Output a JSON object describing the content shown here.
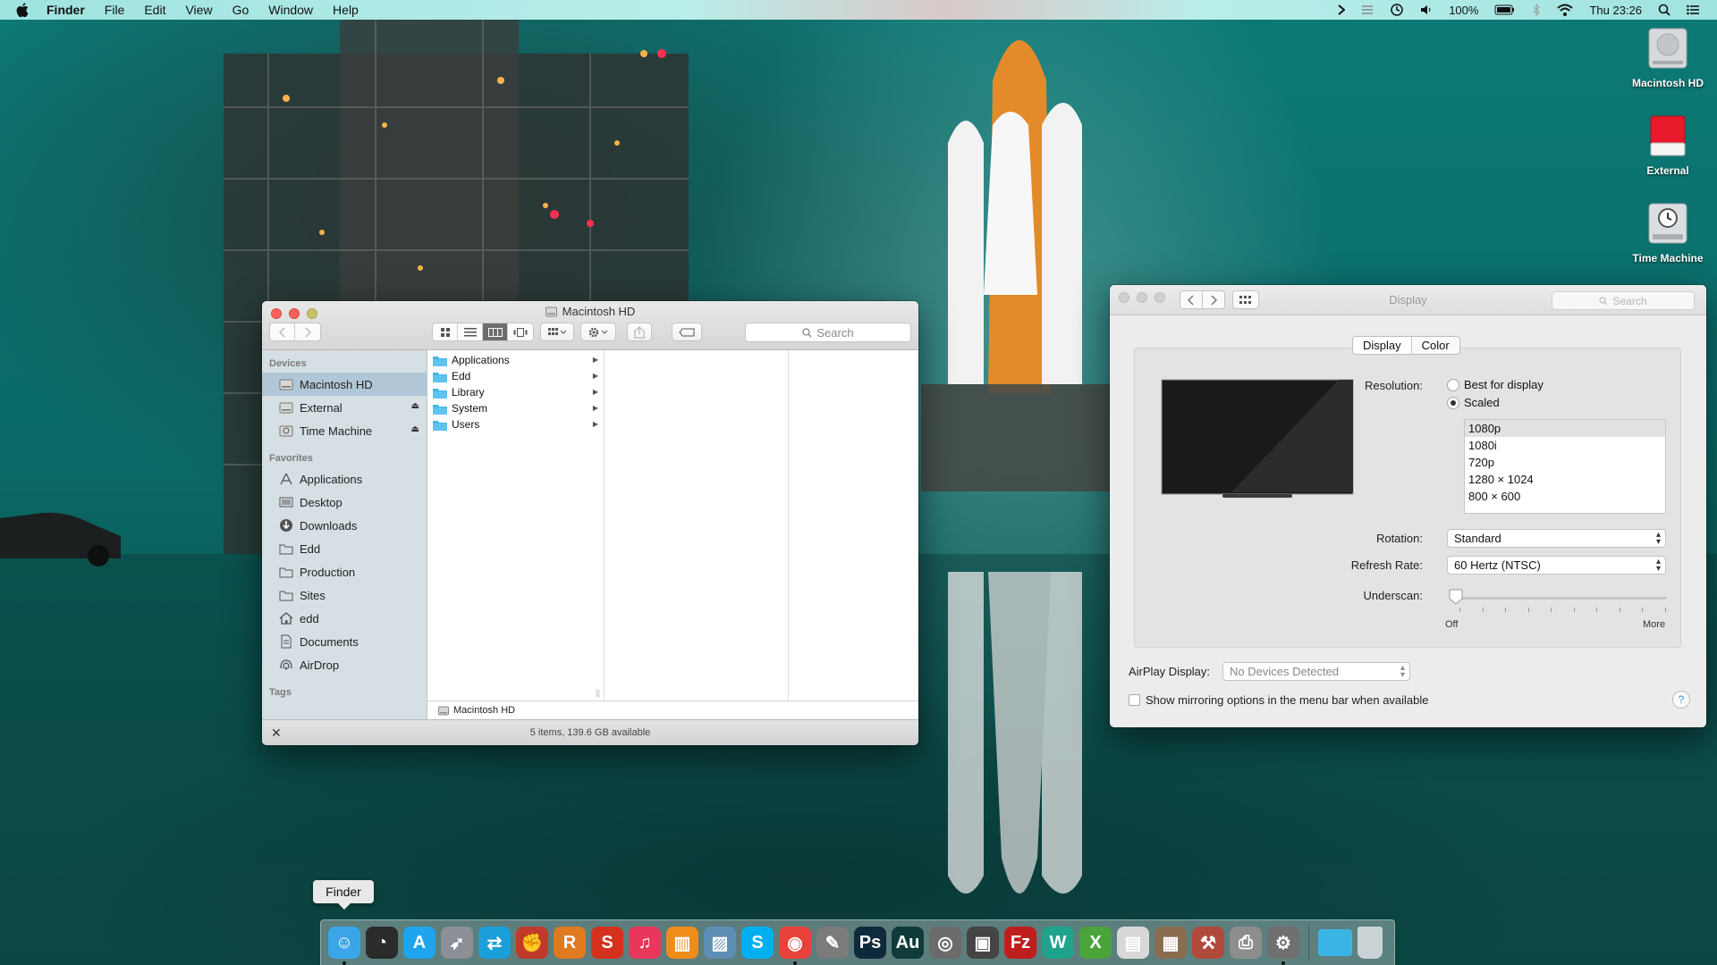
{
  "menubar": {
    "app_name": "Finder",
    "menus": [
      "File",
      "Edit",
      "View",
      "Go",
      "Window",
      "Help"
    ],
    "battery": "100%",
    "clock": "Thu 23:26",
    "icons": [
      "apple-icon",
      "notification-arrow-icon",
      "bartender-icon",
      "time-machine-icon",
      "volume-icon",
      "battery-icon",
      "bluetooth-icon",
      "wifi-icon",
      "spotlight-icon",
      "notification-center-icon"
    ]
  },
  "desktop_icons": [
    {
      "label": "Macintosh HD",
      "icon": "hard-drive-icon"
    },
    {
      "label": "External",
      "icon": "external-drive-icon"
    },
    {
      "label": "Time Machine",
      "icon": "time-machine-drive-icon"
    }
  ],
  "finder": {
    "title": "Macintosh HD",
    "search_placeholder": "Search",
    "sidebar": {
      "devices_header": "Devices",
      "devices": [
        {
          "label": "Macintosh HD",
          "icon": "hard-drive-icon",
          "selected": true
        },
        {
          "label": "External",
          "icon": "external-drive-icon",
          "eject": true
        },
        {
          "label": "Time Machine",
          "icon": "time-machine-icon",
          "eject": true
        }
      ],
      "favorites_header": "Favorites",
      "favorites": [
        {
          "label": "Applications",
          "icon": "applications-icon"
        },
        {
          "label": "Desktop",
          "icon": "desktop-icon"
        },
        {
          "label": "Downloads",
          "icon": "downloads-icon"
        },
        {
          "label": "Edd",
          "icon": "folder-icon"
        },
        {
          "label": "Production",
          "icon": "folder-icon"
        },
        {
          "label": "Sites",
          "icon": "folder-icon"
        },
        {
          "label": "edd",
          "icon": "home-icon"
        },
        {
          "label": "Documents",
          "icon": "documents-icon"
        },
        {
          "label": "AirDrop",
          "icon": "airdrop-icon"
        }
      ],
      "tags_header": "Tags"
    },
    "column1": [
      "Applications",
      "Edd",
      "Library",
      "System",
      "Users"
    ],
    "path_bar": "Macintosh HD",
    "status": "5 items, 139.6 GB available"
  },
  "display_prefs": {
    "title": "Display",
    "search_placeholder": "Search",
    "tabs": [
      "Display",
      "Color"
    ],
    "active_tab": "Display",
    "resolution_label": "Resolution:",
    "resolution_options": [
      "Best for display",
      "Scaled"
    ],
    "resolution_selected": "Scaled",
    "scaled_list": [
      "1080p",
      "1080i",
      "720p",
      "1280 × 1024",
      "800 × 600"
    ],
    "scaled_selected": "1080p",
    "rotation_label": "Rotation:",
    "rotation_value": "Standard",
    "refresh_label": "Refresh Rate:",
    "refresh_value": "60 Hertz (NTSC)",
    "underscan_label": "Underscan:",
    "underscan_min": "Off",
    "underscan_max": "More",
    "underscan_value": 0,
    "airplay_label": "AirPlay Display:",
    "airplay_value": "No Devices Detected",
    "mirroring_label": "Show mirroring options in the menu bar when available",
    "mirroring_checked": false,
    "help_label": "?"
  },
  "dock": {
    "tooltip": "Finder",
    "apps": [
      {
        "name": "finder-icon",
        "glyph": "☺",
        "color": "#3aa6e8",
        "running": true
      },
      {
        "name": "dashboard-icon",
        "glyph": "◔",
        "color": "#2b2b2b",
        "running": false
      },
      {
        "name": "app-store-icon",
        "glyph": "A",
        "color": "#1ea5ee",
        "running": false
      },
      {
        "name": "launchpad-icon",
        "glyph": "➶",
        "color": "#8c8f95",
        "running": false
      },
      {
        "name": "teamviewer-icon",
        "glyph": "⇄",
        "color": "#1a9fd9",
        "running": false
      },
      {
        "name": "boxing-glove-icon",
        "glyph": "✊",
        "color": "#c0392b",
        "running": false
      },
      {
        "name": "r-app-icon",
        "glyph": "R",
        "color": "#e07a1f",
        "running": false
      },
      {
        "name": "s-app-icon",
        "glyph": "S",
        "color": "#d4321c",
        "running": false
      },
      {
        "name": "itunes-icon",
        "glyph": "♫",
        "color": "#e8375b",
        "running": false
      },
      {
        "name": "ibooks-icon",
        "glyph": "▥",
        "color": "#f08c1a",
        "running": false
      },
      {
        "name": "preview-icon",
        "glyph": "▨",
        "color": "#5d8fb4",
        "running": false
      },
      {
        "name": "skype-icon",
        "glyph": "S",
        "color": "#00aff0",
        "running": false
      },
      {
        "name": "chrome-icon",
        "glyph": "◉",
        "color": "#e8423a",
        "running": true
      },
      {
        "name": "script-editor-icon",
        "glyph": "✎",
        "color": "#7b7b7b",
        "running": false
      },
      {
        "name": "photoshop-icon",
        "glyph": "Ps",
        "color": "#0f2a3d",
        "running": false
      },
      {
        "name": "audition-icon",
        "glyph": "Au",
        "color": "#0f3b3a",
        "running": false
      },
      {
        "name": "disk-utility-icon",
        "glyph": "◎",
        "color": "#6b6b6b",
        "running": false
      },
      {
        "name": "screenflow-icon",
        "glyph": "▣",
        "color": "#444444",
        "running": false
      },
      {
        "name": "filezilla-icon",
        "glyph": "Fz",
        "color": "#bf1e1e",
        "running": false
      },
      {
        "name": "w-app-icon",
        "glyph": "W",
        "color": "#1fa38c",
        "running": false
      },
      {
        "name": "x-app-icon",
        "glyph": "X",
        "color": "#4aa43a",
        "running": false
      },
      {
        "name": "textedit-icon",
        "glyph": "▤",
        "color": "#d8d8d8",
        "running": false
      },
      {
        "name": "calculator-icon",
        "glyph": "▦",
        "color": "#8a6d4f",
        "running": false
      },
      {
        "name": "toolbox-icon",
        "glyph": "⚒",
        "color": "#b04a3a",
        "running": false
      },
      {
        "name": "printer-icon",
        "glyph": "⎙",
        "color": "#8d8d8d",
        "running": false
      },
      {
        "name": "system-preferences-icon",
        "glyph": "⚙",
        "color": "#6f6f6f",
        "running": true
      }
    ],
    "stack": {
      "name": "folder-stack-icon",
      "glyph": "",
      "color": "#3ab6e6"
    },
    "trash": {
      "name": "trash-icon",
      "glyph": "",
      "color": "#c9d3d6"
    }
  }
}
